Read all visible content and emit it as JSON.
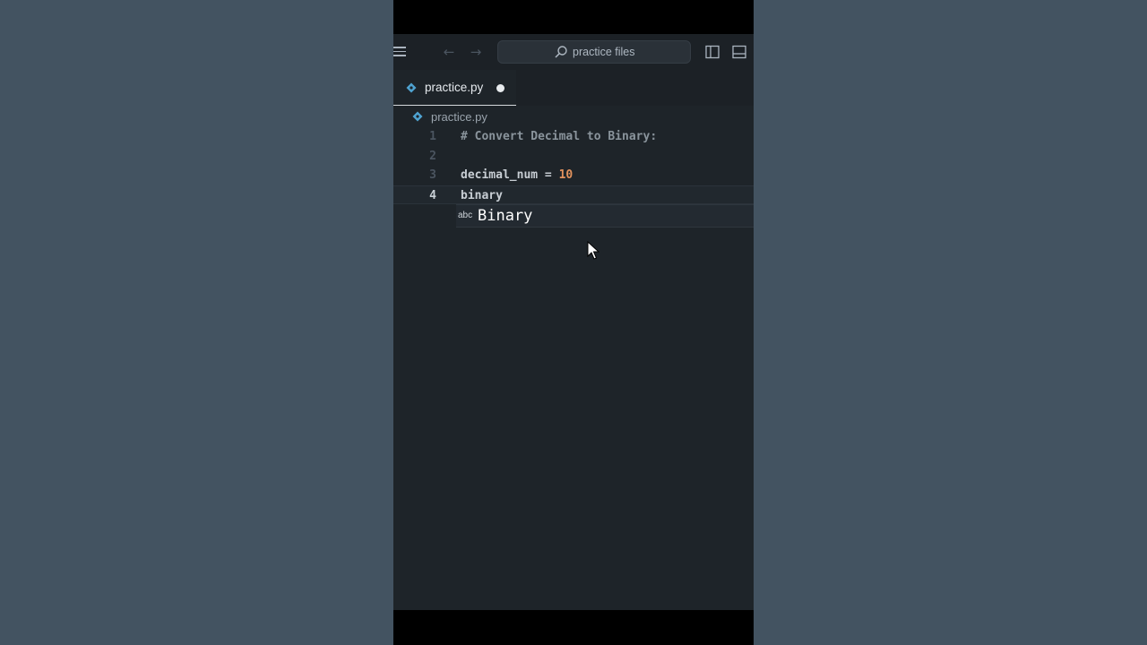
{
  "titlebar": {
    "search_text": "practice files",
    "back_arrow": "←",
    "forward_arrow": "→",
    "icons": [
      "menu-icon",
      "back-arrow-icon",
      "forward-arrow-icon",
      "search-icon",
      "toggle-sidebar-icon",
      "toggle-panel-icon"
    ]
  },
  "tab": {
    "label": "practice.py",
    "dirty": true,
    "icon": "python-icon"
  },
  "breadcrumb": {
    "label": "practice.py",
    "icon": "python-icon"
  },
  "code": {
    "lines": [
      {
        "number": "1",
        "comment": "# Convert Decimal to Binary:"
      },
      {
        "number": "2"
      },
      {
        "number": "3",
        "identifier": "decimal_num",
        "operator": " = ",
        "value": "10"
      },
      {
        "number": "4",
        "text": "binary"
      }
    ]
  },
  "suggestion": {
    "kind": "abc",
    "label": "Binary"
  },
  "colors": {
    "background": "#435361",
    "editor": "#1e2429",
    "number_literal": "#e2925d",
    "comment": "#8a949c",
    "python_icon": "#4fa3d1"
  }
}
